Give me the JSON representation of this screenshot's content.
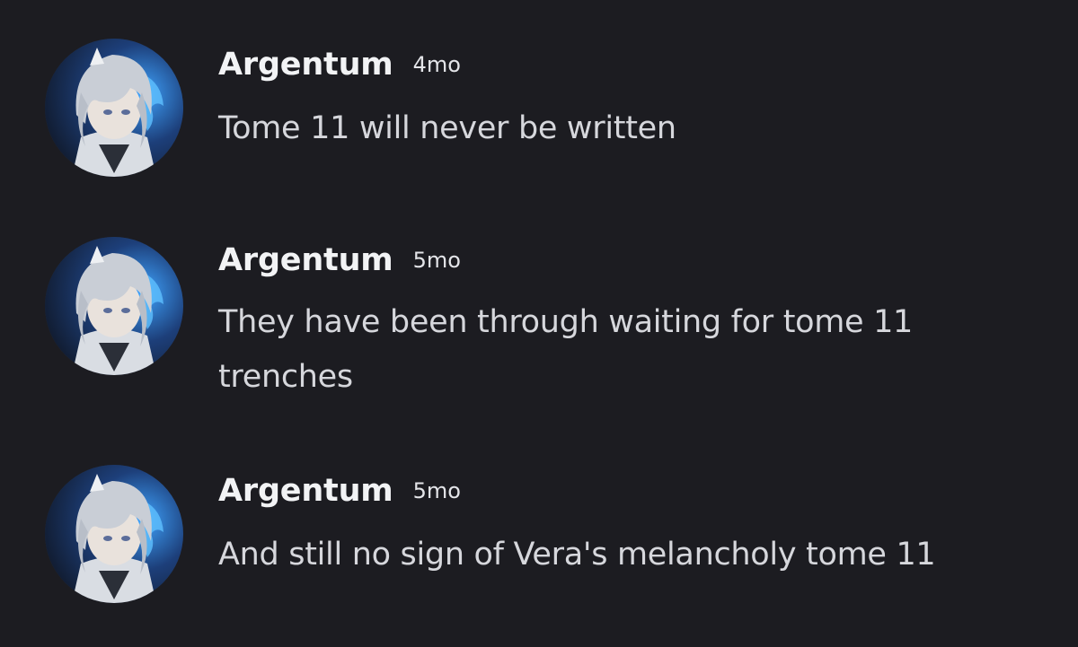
{
  "colors": {
    "background": "#1c1c21",
    "author": "#f2f3f5",
    "text": "#d6d7dc",
    "avatar_accent": "#3fa4ff"
  },
  "messages": [
    {
      "author": "Argentum",
      "time": "4mo",
      "text": "Tome 11 will never be written",
      "avatar_icon": "avatar-image"
    },
    {
      "author": "Argentum",
      "time": "5mo",
      "text": "They have been through waiting for tome 11 trenches",
      "avatar_icon": "avatar-image"
    },
    {
      "author": "Argentum",
      "time": "5mo",
      "text": "And still no sign of Vera's melancholy tome 11",
      "avatar_icon": "avatar-image"
    }
  ]
}
